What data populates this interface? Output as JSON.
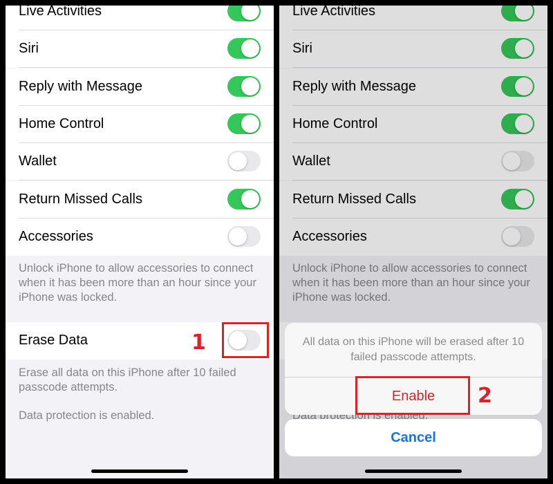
{
  "colors": {
    "toggle_on": "#34c759",
    "destructive": "#d8232a",
    "link": "#1a73d9",
    "annotation": "#d8232a"
  },
  "left_panel": {
    "rows": [
      {
        "label": "Live Activities",
        "on": true
      },
      {
        "label": "Siri",
        "on": true
      },
      {
        "label": "Reply with Message",
        "on": true
      },
      {
        "label": "Home Control",
        "on": true
      },
      {
        "label": "Wallet",
        "on": false
      },
      {
        "label": "Return Missed Calls",
        "on": true
      },
      {
        "label": "Accessories",
        "on": false
      }
    ],
    "accessories_footer": "Unlock iPhone to allow accessories to connect when it has been more than an hour since your iPhone was locked.",
    "erase_row": {
      "label": "Erase Data",
      "on": false
    },
    "erase_footer": "Erase all data on this iPhone after 10 failed passcode attempts.",
    "protection_note": "Data protection is enabled.",
    "annotation": "1"
  },
  "right_panel": {
    "rows": [
      {
        "label": "Live Activities",
        "on": true
      },
      {
        "label": "Siri",
        "on": true
      },
      {
        "label": "Reply with Message",
        "on": true
      },
      {
        "label": "Home Control",
        "on": true
      },
      {
        "label": "Wallet",
        "on": false
      },
      {
        "label": "Return Missed Calls",
        "on": true
      },
      {
        "label": "Accessories",
        "on": false
      }
    ],
    "accessories_footer": "Unlock iPhone to allow accessories to connect when it has been more than an hour since your iPhone was locked.",
    "protection_note": "Data protection is enabled.",
    "action_sheet": {
      "message": "All data on this iPhone will be erased after 10 failed passcode attempts.",
      "enable_label": "Enable",
      "cancel_label": "Cancel"
    },
    "annotation": "2"
  }
}
